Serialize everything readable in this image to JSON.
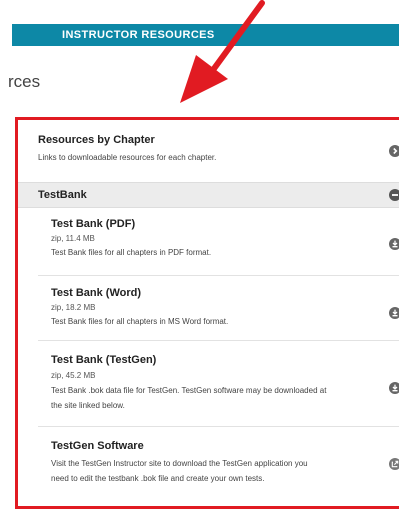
{
  "header": {
    "title": "INSTRUCTOR RESOURCES"
  },
  "page": {
    "heading": "rces"
  },
  "resources": {
    "by_chapter": {
      "title": "Resources by Chapter",
      "description": "Links to downloadable resources for each chapter."
    },
    "testbank_section": {
      "title": "TestBank"
    },
    "items": [
      {
        "title": "Test Bank (PDF)",
        "meta": "zip, 11.4 MB",
        "description": "Test Bank files for all chapters in PDF format."
      },
      {
        "title": "Test Bank (Word)",
        "meta": "zip, 18.2 MB",
        "description": "Test Bank files for all chapters in MS Word format."
      },
      {
        "title": "Test Bank (TestGen)",
        "meta": "zip, 45.2 MB",
        "description_line1": "Test Bank .bok data file for TestGen. TestGen software may be downloaded at",
        "description_line2": "the site linked below."
      },
      {
        "title": "TestGen Software",
        "description_line1": "Visit the TestGen Instructor site to download the TestGen application you",
        "description_line2": "need to edit the testbank .bok file and create your own tests."
      }
    ]
  },
  "colors": {
    "accent": "#0d88a6",
    "highlight": "#e11b22",
    "icon": "#666666"
  },
  "icons": {
    "expand": "chevron-right-circle-icon",
    "collapse": "minus-circle-icon",
    "download": "download-circle-icon",
    "external": "external-link-icon",
    "annotation": "red-arrow-annotation"
  }
}
